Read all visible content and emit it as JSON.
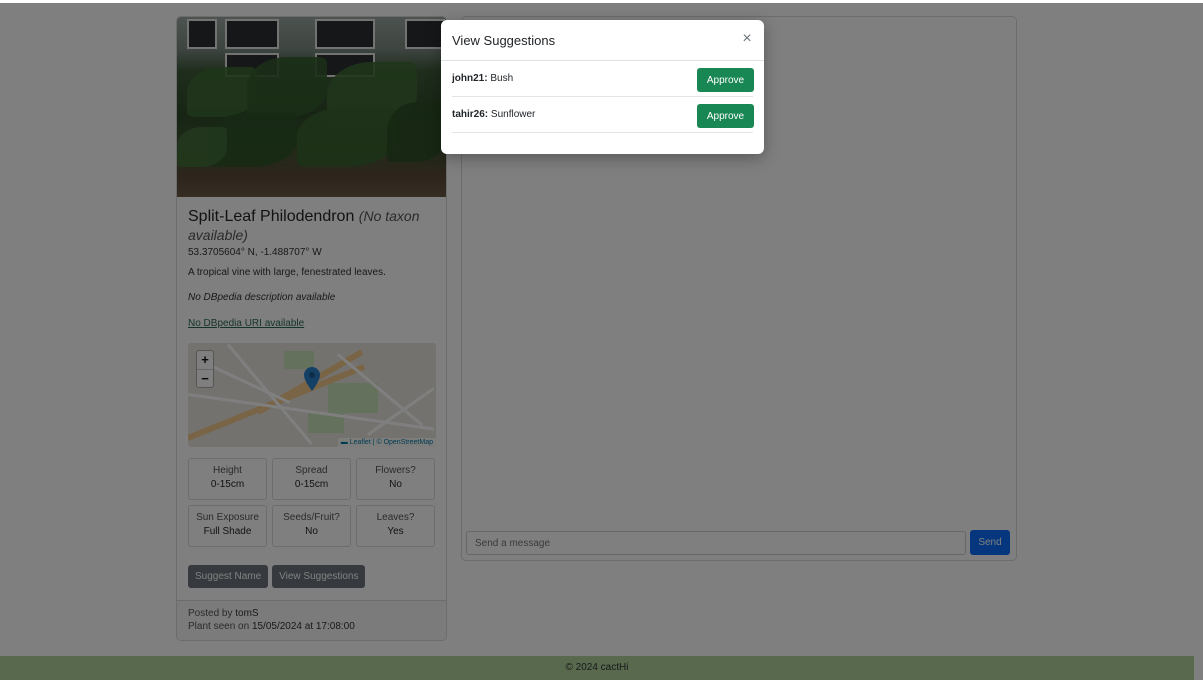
{
  "plant": {
    "name": "Split-Leaf Philodendron",
    "taxon": "(No taxon available)",
    "coordinates": "53.3705604° N, -1.488707° W",
    "description": "A tropical vine with large, fenestrated leaves.",
    "dbpedia_description": "No DBpedia description available",
    "dbpedia_uri": "No DBpedia URI available"
  },
  "map": {
    "zoom_in": "+",
    "zoom_out": "−",
    "attribution": "▬ Leaflet | © OpenStreetMap"
  },
  "attributes": [
    {
      "label": "Height",
      "value": "0-15cm"
    },
    {
      "label": "Spread",
      "value": "0-15cm"
    },
    {
      "label": "Flowers?",
      "value": "No"
    },
    {
      "label": "Sun Exposure",
      "value": "Full Shade"
    },
    {
      "label": "Seeds/Fruit?",
      "value": "No"
    },
    {
      "label": "Leaves?",
      "value": "Yes"
    }
  ],
  "actions": {
    "suggest_name": "Suggest Name",
    "view_suggestions": "View Suggestions"
  },
  "posted": {
    "prefix": "Posted by ",
    "user": "tomS",
    "seen_prefix": "Plant seen on ",
    "seen_date": "15/05/2024 at 17:08:00"
  },
  "chat": {
    "placeholder": "Send a message",
    "send_label": "Send"
  },
  "footer": {
    "text": "© 2024 cactHi"
  },
  "modal": {
    "title": "View Suggestions",
    "close": "×",
    "approve_label": "Approve",
    "suggestions": [
      {
        "user": "john21:",
        "name": " Bush"
      },
      {
        "user": "tahir26:",
        "name": " Sunflower"
      }
    ]
  },
  "colors": {
    "approve": "#198754",
    "send": "#0d6efd",
    "secondary": "#6c757d",
    "footer": "#b0d29c"
  }
}
